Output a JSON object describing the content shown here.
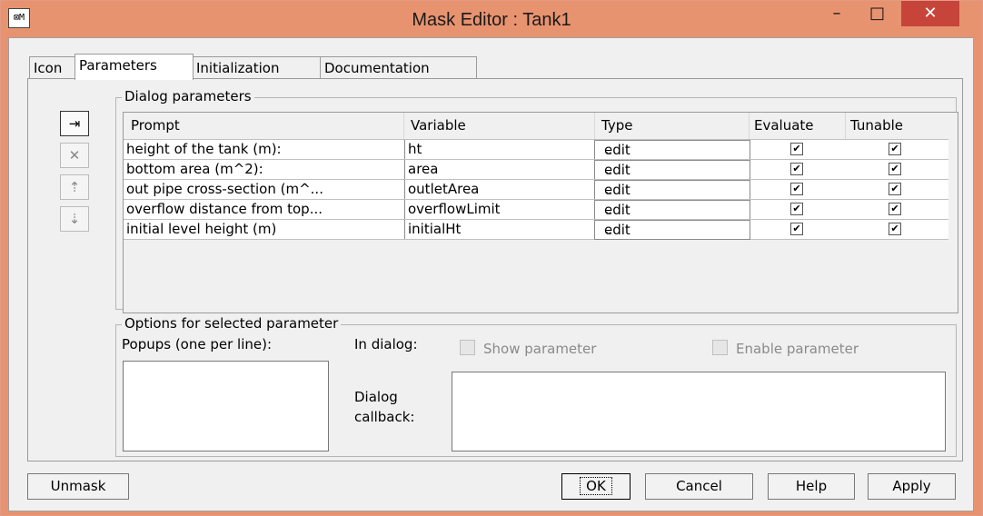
{
  "window": {
    "title": "Mask Editor : Tank1",
    "minimize": "–",
    "maximize": "□",
    "close": "✕",
    "app_icon": "⊠M"
  },
  "tabs": [
    "Icon",
    "Parameters",
    "Initialization",
    "Documentation"
  ],
  "dialog_params": {
    "legend": "Dialog parameters",
    "columns": [
      "Prompt",
      "Variable",
      "Type",
      "Evaluate",
      "Tunable"
    ],
    "rows": [
      {
        "prompt": "height of the tank (m):",
        "variable": "ht",
        "type": "edit",
        "evaluate": "✔",
        "tunable": "✔"
      },
      {
        "prompt": "bottom area (m^2):",
        "variable": "area",
        "type": "edit",
        "evaluate": "✔",
        "tunable": "✔"
      },
      {
        "prompt": "out pipe cross-section (m^...",
        "variable": "outletArea",
        "type": "edit",
        "evaluate": "✔",
        "tunable": "✔"
      },
      {
        "prompt": "overflow distance from top...",
        "variable": "overflowLimit",
        "type": "edit",
        "evaluate": "✔",
        "tunable": "✔"
      },
      {
        "prompt": "initial level height (m)",
        "variable": "initialHt",
        "type": "edit",
        "evaluate": "✔",
        "tunable": "✔"
      }
    ],
    "side_buttons": [
      "⇥",
      "✕",
      "⇡",
      "⇣"
    ]
  },
  "options": {
    "legend": "Options for selected parameter",
    "popups_label": "Popups (one per line):",
    "in_dialog_label": "In dialog:",
    "show_parameter": "Show parameter",
    "enable_parameter": "Enable parameter",
    "dialog_callback_line1": "Dialog",
    "dialog_callback_line2": "callback:"
  },
  "buttons": {
    "unmask": "Unmask",
    "ok": "OK",
    "cancel": "Cancel",
    "help": "Help",
    "apply": "Apply"
  }
}
